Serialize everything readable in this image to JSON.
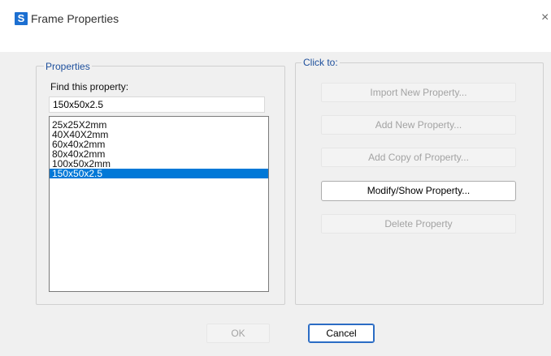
{
  "window": {
    "title": "Frame Properties",
    "app_icon_letter": "S",
    "close_glyph": "×"
  },
  "properties_group": {
    "legend": "Properties",
    "find_label": "Find this property:",
    "find_value": "150x50x2.5",
    "items": [
      "25x25X2mm",
      "40X40X2mm",
      "60x40x2mm",
      "80x40x2mm",
      "100x50x2mm",
      "150x50x2.5"
    ],
    "selected_index": 5
  },
  "click_to_group": {
    "legend": "Click to:",
    "import_new": "Import New Property...",
    "add_new": "Add New Property...",
    "add_copy": "Add Copy of Property...",
    "modify_show": "Modify/Show Property...",
    "delete": "Delete Property"
  },
  "footer": {
    "ok": "OK",
    "cancel": "Cancel"
  },
  "colors": {
    "selection": "#0078d7",
    "legend_text": "#1d4f9c",
    "app_icon": "#1c6fd1"
  }
}
